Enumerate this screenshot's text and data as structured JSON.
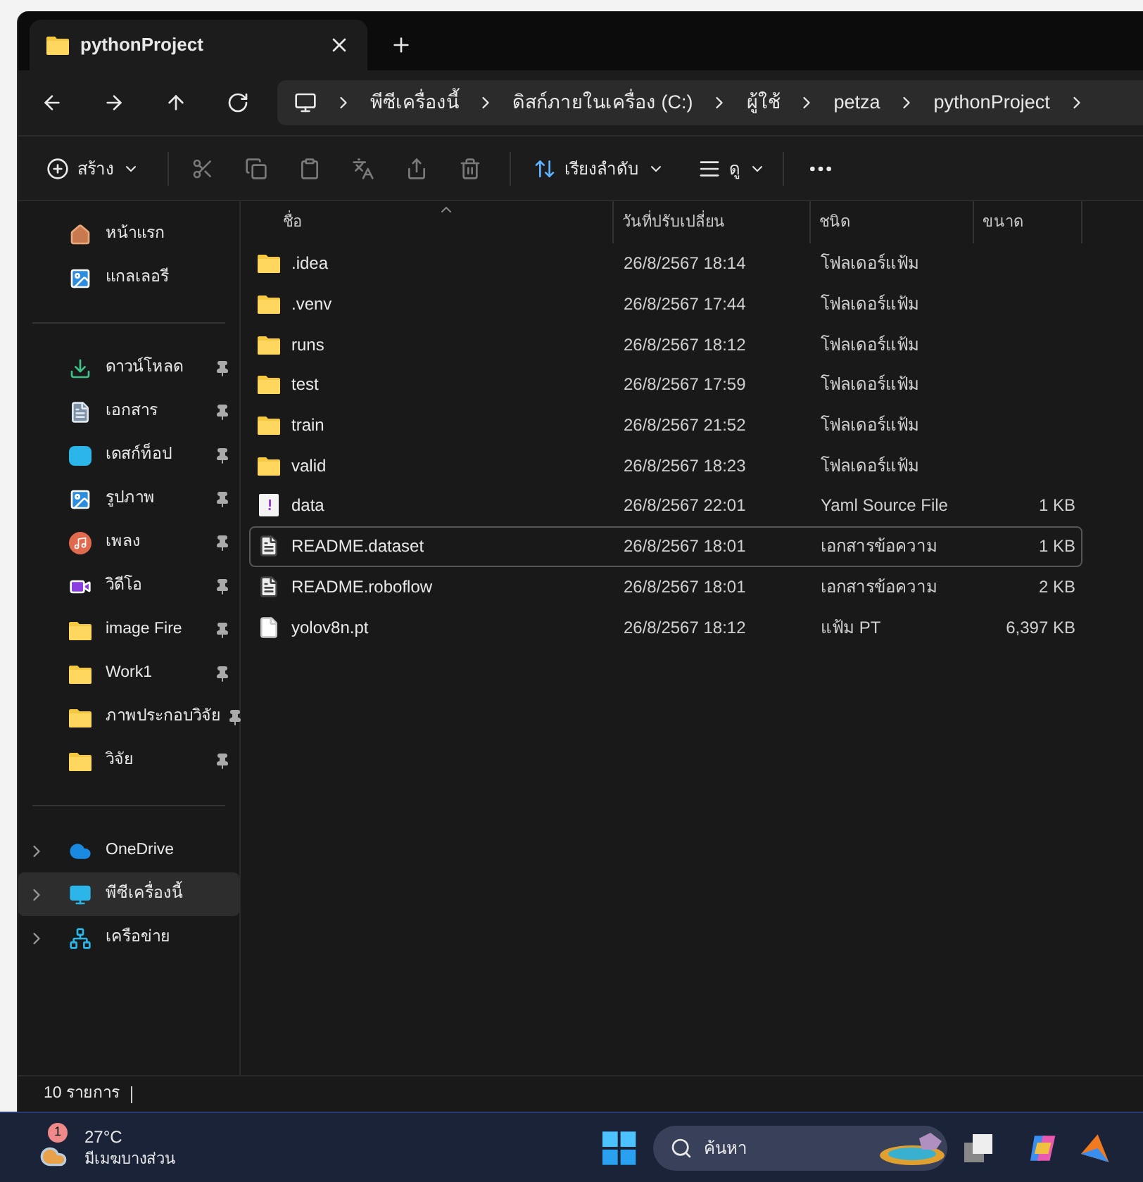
{
  "tab": {
    "title": "pythonProject",
    "selected": true
  },
  "address": {
    "crumbs": [
      "พีซีเครื่องนี้",
      "ดิสก์ภายในเครื่อง (C:)",
      "ผู้ใช้",
      "petza",
      "pythonProject"
    ]
  },
  "toolbar": {
    "new_label": "สร้าง",
    "sort_label": "เรียงลำดับ",
    "view_label": "ดู"
  },
  "sidebar": {
    "groups": [
      [
        {
          "label": "หน้าแรก",
          "kind": "home",
          "pinned": false,
          "selected": false
        },
        {
          "label": "แกลเลอรี",
          "kind": "gallery",
          "pinned": false,
          "selected": false
        }
      ],
      [
        {
          "label": "ดาวน์โหลด",
          "kind": "download",
          "pinned": true,
          "selected": false
        },
        {
          "label": "เอกสาร",
          "kind": "document",
          "pinned": true,
          "selected": false
        },
        {
          "label": "เดสก์ท็อป",
          "kind": "desktop",
          "pinned": true,
          "selected": false
        },
        {
          "label": "รูปภาพ",
          "kind": "pictures",
          "pinned": true,
          "selected": false
        },
        {
          "label": "เพลง",
          "kind": "music",
          "pinned": true,
          "selected": false
        },
        {
          "label": "วิดีโอ",
          "kind": "video",
          "pinned": true,
          "selected": false
        },
        {
          "label": "image Fire",
          "kind": "folder",
          "pinned": true,
          "selected": false
        },
        {
          "label": "Work1",
          "kind": "folder",
          "pinned": true,
          "selected": false
        },
        {
          "label": "ภาพประกอบวิจัย",
          "kind": "folder",
          "pinned": true,
          "selected": false
        },
        {
          "label": "วิจัย",
          "kind": "folder",
          "pinned": true,
          "selected": false
        }
      ],
      [
        {
          "label": "OneDrive",
          "kind": "cloud",
          "expandable": true,
          "selected": false
        },
        {
          "label": "พีซีเครื่องนี้",
          "kind": "pc",
          "expandable": true,
          "selected": true
        },
        {
          "label": "เครือข่าย",
          "kind": "network",
          "expandable": true,
          "selected": false
        }
      ]
    ]
  },
  "table": {
    "columns": [
      "ชื่อ",
      "วันที่ปรับเปลี่ยน",
      "ชนิด",
      "ขนาด"
    ],
    "rows": [
      {
        "name": ".idea",
        "modified": "26/8/2567 18:14",
        "type": "โฟลเดอร์แฟ้ม",
        "kind": "folder",
        "selected": false
      },
      {
        "name": ".venv",
        "modified": "26/8/2567 17:44",
        "type": "โฟลเดอร์แฟ้ม",
        "kind": "folder",
        "selected": false
      },
      {
        "name": "runs",
        "modified": "26/8/2567 18:12",
        "type": "โฟลเดอร์แฟ้ม",
        "kind": "folder",
        "selected": false
      },
      {
        "name": "test",
        "modified": "26/8/2567 17:59",
        "type": "โฟลเดอร์แฟ้ม",
        "kind": "folder",
        "selected": false
      },
      {
        "name": "train",
        "modified": "26/8/2567 21:52",
        "type": "โฟลเดอร์แฟ้ม",
        "kind": "folder",
        "selected": false
      },
      {
        "name": "valid",
        "modified": "26/8/2567 18:23",
        "type": "โฟลเดอร์แฟ้ม",
        "kind": "folder",
        "selected": false
      },
      {
        "name": "data",
        "modified": "26/8/2567 22:01",
        "type": "Yaml Source File",
        "size": "1 KB",
        "kind": "yaml",
        "selected": false
      },
      {
        "name": "README.dataset",
        "modified": "26/8/2567 18:01",
        "type": "เอกสารข้อความ",
        "size": "1 KB",
        "kind": "text",
        "selected": true
      },
      {
        "name": "README.roboflow",
        "modified": "26/8/2567 18:01",
        "type": "เอกสารข้อความ",
        "size": "2 KB",
        "kind": "text",
        "selected": false
      },
      {
        "name": "yolov8n.pt",
        "modified": "26/8/2567 18:12",
        "type": "แฟ้ม PT",
        "size": "6,397 KB",
        "kind": "file",
        "selected": false
      }
    ]
  },
  "status_bar": {
    "count": "10 รายการ"
  },
  "taskbar": {
    "weather": {
      "badge": "1",
      "temperature": "27°C",
      "condition": "มีเมฆบางส่วน"
    },
    "search": {
      "placeholder": "ค้นหา"
    }
  }
}
